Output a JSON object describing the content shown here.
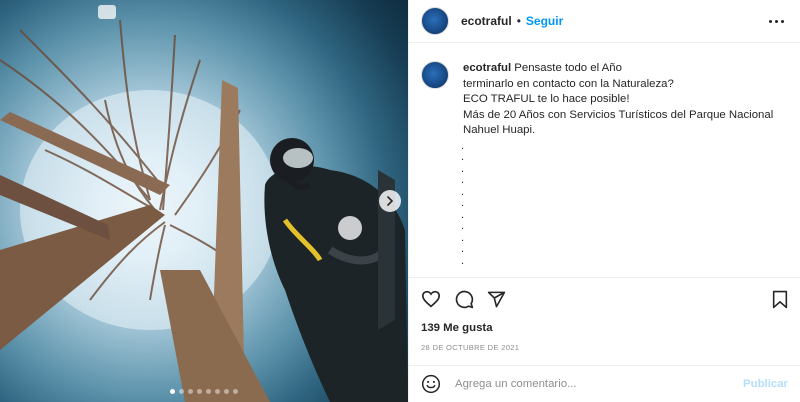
{
  "post": {
    "author": "ecotraful",
    "separator": "•",
    "follow_label": "Seguir",
    "more_icon": "more-horizontal-icon"
  },
  "media": {
    "description_icons": [
      "chevron-right-icon"
    ],
    "carousel": {
      "total": 8,
      "active": 1
    }
  },
  "caption": {
    "author": "ecotraful",
    "text": "Pensaste todo el Año\nterminarlo en contacto con la Naturaleza?\nECO TRAFUL te lo hace posible!\nMás de 20 Años con Servicios Turísticos del Parque Nacional Nahuel Huapi.",
    "dots": ".\n.\n.\n.\n.\n.\n.\n.\n.\n.\n."
  },
  "actions": {
    "icons": [
      "heart-icon",
      "comment-icon",
      "share-icon",
      "bookmark-icon"
    ]
  },
  "likes": "139 Me gusta",
  "date": "28 DE OCTUBRE DE 2021",
  "add_comment": {
    "placeholder": "Agrega un comentario...",
    "publish_label": "Publicar",
    "emoji_icon": "smiley-icon"
  },
  "colors": {
    "accent": "#0095f6",
    "publish_disabled": "#b2dffc",
    "text": "#262626",
    "muted": "#8e8e8e"
  }
}
